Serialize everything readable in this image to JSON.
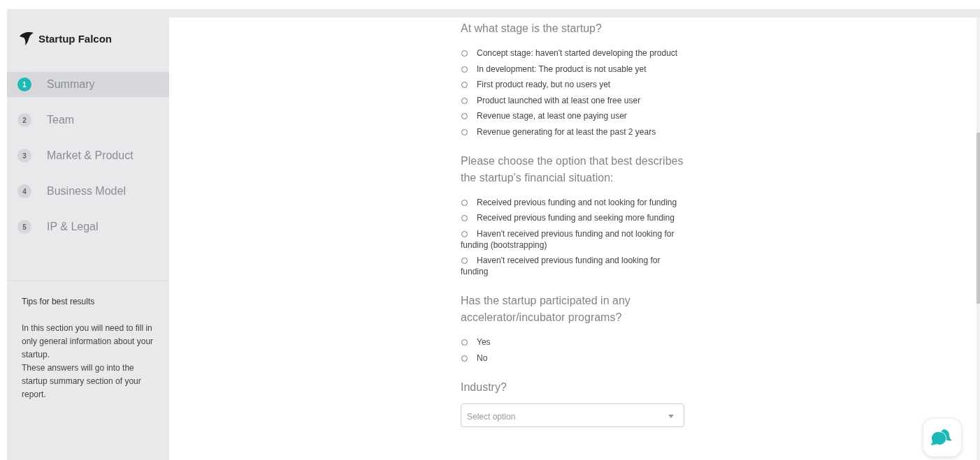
{
  "sidebar": {
    "brand": "Startup Falcon",
    "steps": [
      {
        "number": "1",
        "label": "Summary",
        "selected": true
      },
      {
        "number": "2",
        "label": "Team",
        "selected": false
      },
      {
        "number": "3",
        "label": "Market & Product",
        "selected": false
      },
      {
        "number": "4",
        "label": "Business Model",
        "selected": false
      },
      {
        "number": "5",
        "label": "IP & Legal",
        "selected": false
      }
    ],
    "tips": {
      "title": "Tips for best results",
      "paragraphs": [
        "In this section you will need to fill in only general information about your startup.",
        "These answers will go into the startup summary section of your report."
      ]
    }
  },
  "questions": [
    {
      "kind": "radio",
      "prompt": "At what stage is the startup?",
      "options": [
        {
          "label": "Concept stage: haven't started developing the product",
          "selected": false
        },
        {
          "label": "In development: The product is not usable yet",
          "selected": false
        },
        {
          "label": "First product ready, but no users yet",
          "selected": false
        },
        {
          "label": "Product launched with at least one free user",
          "selected": false
        },
        {
          "label": "Revenue stage, at least one paying user",
          "selected": false
        },
        {
          "label": "Revenue generating for at least the past 2 years",
          "selected": false
        }
      ]
    },
    {
      "kind": "radio",
      "prompt": "Please choose the option that best describes the startup’s financial situation:",
      "options": [
        {
          "label": "Received previous funding and not looking for funding",
          "selected": false
        },
        {
          "label": "Received previous funding and seeking more funding",
          "selected": false
        },
        {
          "label": "Haven't received previous funding and not looking for funding (bootstrapping)",
          "selected": false
        },
        {
          "label": "Haven't received previous funding and looking for funding",
          "selected": false
        }
      ]
    },
    {
      "kind": "radio",
      "prompt": "Has the startup participated in any accelerator/incubator programs?",
      "options": [
        {
          "label": "Yes",
          "selected": false
        },
        {
          "label": "No",
          "selected": false
        }
      ]
    },
    {
      "kind": "select",
      "prompt": "Industry?",
      "placeholder": "Select option"
    }
  ]
}
